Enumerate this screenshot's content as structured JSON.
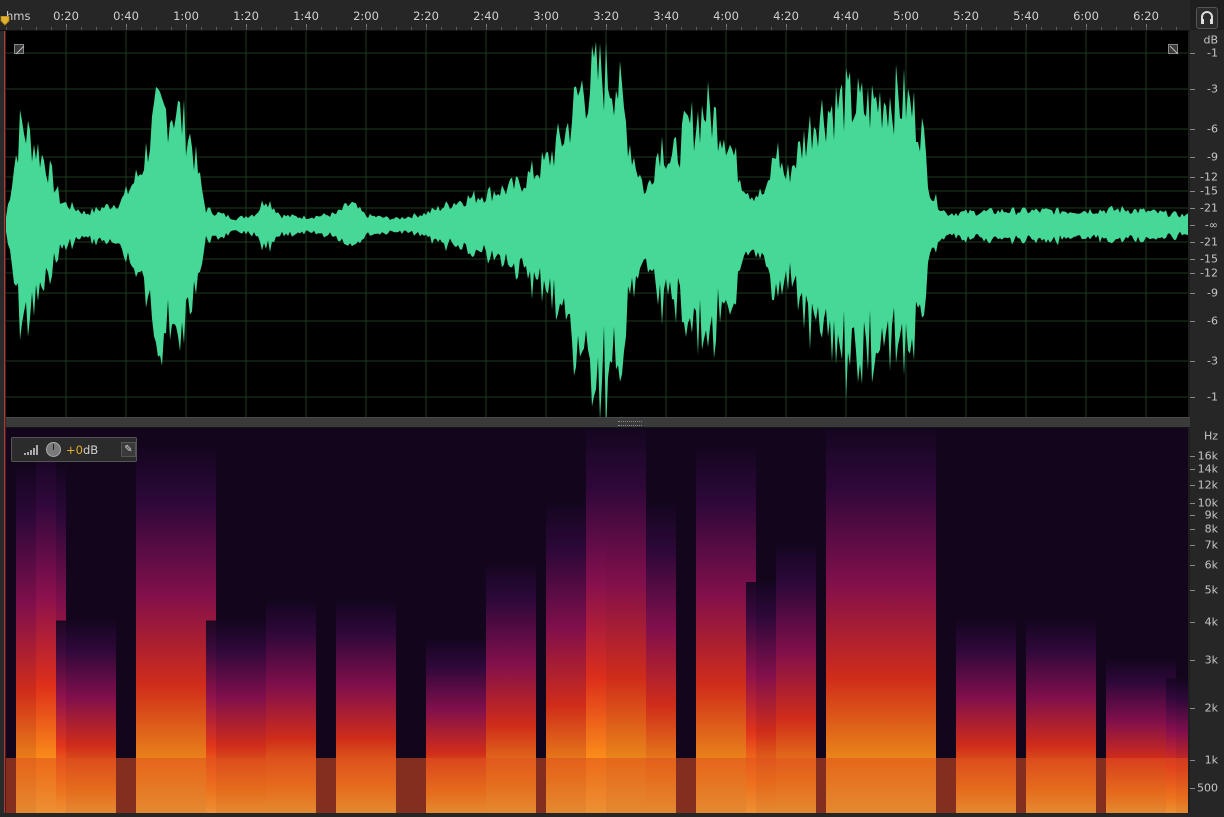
{
  "ruler": {
    "unit": "hms",
    "ticks": [
      "0:20",
      "0:40",
      "1:00",
      "1:20",
      "1:40",
      "2:00",
      "2:20",
      "2:40",
      "3:00",
      "3:20",
      "3:40",
      "4:00",
      "4:20",
      "4:40",
      "5:00",
      "5:20",
      "5:40",
      "6:00",
      "6:20"
    ]
  },
  "waveform": {
    "color": "#45d896",
    "db_scale_title": "dB",
    "db_labels": [
      "-1",
      "-3",
      "-6",
      "-9",
      "-12",
      "-15",
      "-21",
      "-∞",
      "-21",
      "-15",
      "-12",
      "-9",
      "-6",
      "-3",
      "-1"
    ]
  },
  "spectral": {
    "hz_scale_title": "Hz",
    "hz_labels": [
      "16k",
      "14k",
      "12k",
      "10k",
      "9k",
      "8k",
      "7k",
      "6k",
      "5k",
      "4k",
      "3k",
      "2k",
      "1k",
      "500"
    ],
    "gain_hud": {
      "value": "+0",
      "unit": "dB",
      "pin_icon": "pin-icon"
    }
  },
  "icons": {
    "headphones": "headphones-icon",
    "playhead": "playhead-marker-icon",
    "zoom_left": "zoom-corner-icon",
    "zoom_right": "zoom-corner-icon"
  },
  "colors": {
    "accent": "#e0b030",
    "waveform": "#45d896",
    "playhead": "#c83030"
  }
}
